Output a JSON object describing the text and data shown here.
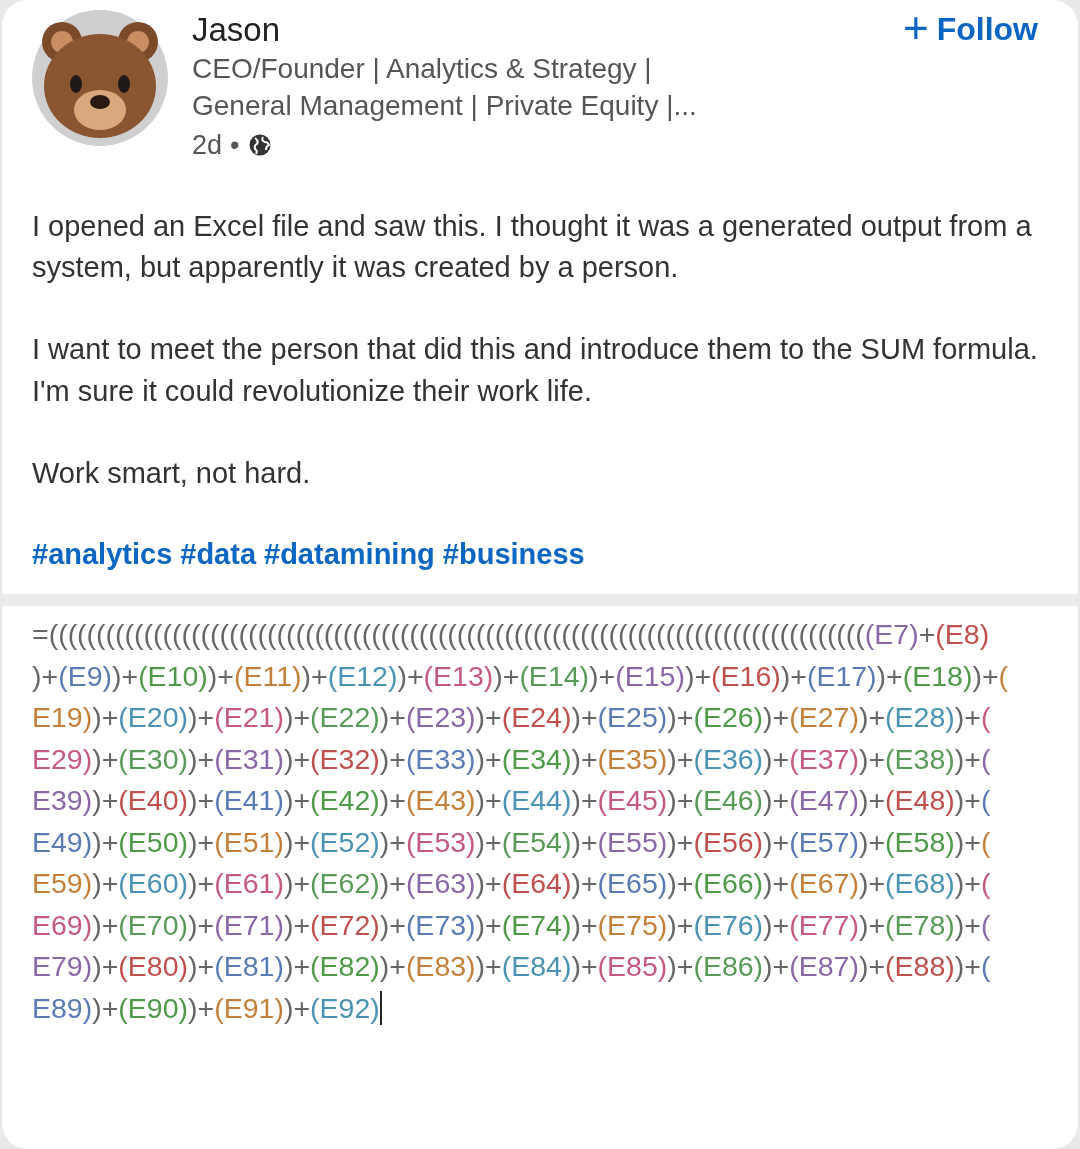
{
  "author": {
    "name": "Jason",
    "headline_lines": [
      "CEO/Founder | Analytics & Strategy |",
      "General Management | Private Equity |..."
    ],
    "time": "2d",
    "separator": "•"
  },
  "follow_button": {
    "icon": "+",
    "label": "Follow"
  },
  "post": {
    "paragraphs": [
      "I opened an Excel file and saw this. I thought it was a generated output from a system, but apparently it was created by a person.",
      "I want to meet the person that did this and introduce them to the SUM formula. I'm sure it could revolutionize their work life.",
      "Work smart, not hard."
    ],
    "hashtags": [
      "#analytics",
      "#data",
      "#datamining",
      "#business"
    ]
  },
  "formula": {
    "cursor_visible": true,
    "lines": [
      [
        {
          "text": "=((((((((((((((((((((((((((((((((((((((((((((((((((((((((((((((((((((((((((((((((((((((",
          "color": "#666666"
        },
        {
          "text": "(E7)",
          "color": "#8a68a8"
        },
        {
          "text": "+",
          "color": "#666666"
        },
        {
          "text": "(E8)",
          "color": "#c0504d"
        }
      ],
      [
        {
          "text": ")+",
          "color": "#666666"
        },
        {
          "text": "(E9)",
          "color": "#5a7bb5"
        },
        {
          "text": ")+",
          "color": "#666666"
        },
        {
          "text": "(E10)",
          "color": "#4e9a48"
        },
        {
          "text": ")+",
          "color": "#666666"
        },
        {
          "text": "(E11)",
          "color": "#c4803a"
        },
        {
          "text": ")+",
          "color": "#666666"
        },
        {
          "text": "(E12)",
          "color": "#4b93b5"
        },
        {
          "text": ")+",
          "color": "#666666"
        },
        {
          "text": "(E13)",
          "color": "#c45a84"
        },
        {
          "text": ")+",
          "color": "#666666"
        },
        {
          "text": "(E14)",
          "color": "#5a9a58"
        },
        {
          "text": ")+",
          "color": "#666666"
        },
        {
          "text": "(E15)",
          "color": "#8a68a8"
        },
        {
          "text": ")+",
          "color": "#666666"
        },
        {
          "text": "(E16)",
          "color": "#c0504d"
        },
        {
          "text": ")+",
          "color": "#666666"
        },
        {
          "text": "(E17)",
          "color": "#5a7bb5"
        },
        {
          "text": ")+",
          "color": "#666666"
        },
        {
          "text": "(E18)",
          "color": "#4e9a48"
        },
        {
          "text": ")+",
          "color": "#666666"
        },
        {
          "text": "(",
          "color": "#c4803a"
        }
      ],
      [
        {
          "text": "E19)",
          "color": "#c4803a"
        },
        {
          "text": ")+",
          "color": "#666666"
        },
        {
          "text": "(E20)",
          "color": "#4b93b5"
        },
        {
          "text": ")+",
          "color": "#666666"
        },
        {
          "text": "(E21)",
          "color": "#c45a84"
        },
        {
          "text": ")+",
          "color": "#666666"
        },
        {
          "text": "(E22)",
          "color": "#5a9a58"
        },
        {
          "text": ")+",
          "color": "#666666"
        },
        {
          "text": "(E23)",
          "color": "#8a68a8"
        },
        {
          "text": ")+",
          "color": "#666666"
        },
        {
          "text": "(E24)",
          "color": "#c0504d"
        },
        {
          "text": ")+",
          "color": "#666666"
        },
        {
          "text": "(E25)",
          "color": "#5a7bb5"
        },
        {
          "text": ")+",
          "color": "#666666"
        },
        {
          "text": "(E26)",
          "color": "#4e9a48"
        },
        {
          "text": ")+",
          "color": "#666666"
        },
        {
          "text": "(E27)",
          "color": "#c4803a"
        },
        {
          "text": ")+",
          "color": "#666666"
        },
        {
          "text": "(E28)",
          "color": "#4b93b5"
        },
        {
          "text": ")+",
          "color": "#666666"
        },
        {
          "text": "(",
          "color": "#c45a84"
        }
      ],
      [
        {
          "text": "E29)",
          "color": "#c45a84"
        },
        {
          "text": ")+",
          "color": "#666666"
        },
        {
          "text": "(E30)",
          "color": "#5a9a58"
        },
        {
          "text": ")+",
          "color": "#666666"
        },
        {
          "text": "(E31)",
          "color": "#8a68a8"
        },
        {
          "text": ")+",
          "color": "#666666"
        },
        {
          "text": "(E32)",
          "color": "#c0504d"
        },
        {
          "text": ")+",
          "color": "#666666"
        },
        {
          "text": "(E33)",
          "color": "#5a7bb5"
        },
        {
          "text": ")+",
          "color": "#666666"
        },
        {
          "text": "(E34)",
          "color": "#4e9a48"
        },
        {
          "text": ")+",
          "color": "#666666"
        },
        {
          "text": "(E35)",
          "color": "#c4803a"
        },
        {
          "text": ")+",
          "color": "#666666"
        },
        {
          "text": "(E36)",
          "color": "#4b93b5"
        },
        {
          "text": ")+",
          "color": "#666666"
        },
        {
          "text": "(E37)",
          "color": "#c45a84"
        },
        {
          "text": ")+",
          "color": "#666666"
        },
        {
          "text": "(E38)",
          "color": "#5a9a58"
        },
        {
          "text": ")+",
          "color": "#666666"
        },
        {
          "text": "(",
          "color": "#8a68a8"
        }
      ],
      [
        {
          "text": "E39)",
          "color": "#8a68a8"
        },
        {
          "text": ")+",
          "color": "#666666"
        },
        {
          "text": "(E40)",
          "color": "#c0504d"
        },
        {
          "text": ")+",
          "color": "#666666"
        },
        {
          "text": "(E41)",
          "color": "#5a7bb5"
        },
        {
          "text": ")+",
          "color": "#666666"
        },
        {
          "text": "(E42)",
          "color": "#4e9a48"
        },
        {
          "text": ")+",
          "color": "#666666"
        },
        {
          "text": "(E43)",
          "color": "#c4803a"
        },
        {
          "text": ")+",
          "color": "#666666"
        },
        {
          "text": "(E44)",
          "color": "#4b93b5"
        },
        {
          "text": ")+",
          "color": "#666666"
        },
        {
          "text": "(E45)",
          "color": "#c45a84"
        },
        {
          "text": ")+",
          "color": "#666666"
        },
        {
          "text": "(E46)",
          "color": "#5a9a58"
        },
        {
          "text": ")+",
          "color": "#666666"
        },
        {
          "text": "(E47)",
          "color": "#8a68a8"
        },
        {
          "text": ")+",
          "color": "#666666"
        },
        {
          "text": "(E48)",
          "color": "#c0504d"
        },
        {
          "text": ")+",
          "color": "#666666"
        },
        {
          "text": "(",
          "color": "#5a7bb5"
        }
      ],
      [
        {
          "text": "E49)",
          "color": "#5a7bb5"
        },
        {
          "text": ")+",
          "color": "#666666"
        },
        {
          "text": "(E50)",
          "color": "#4e9a48"
        },
        {
          "text": ")+",
          "color": "#666666"
        },
        {
          "text": "(E51)",
          "color": "#c4803a"
        },
        {
          "text": ")+",
          "color": "#666666"
        },
        {
          "text": "(E52)",
          "color": "#4b93b5"
        },
        {
          "text": ")+",
          "color": "#666666"
        },
        {
          "text": "(E53)",
          "color": "#c45a84"
        },
        {
          "text": ")+",
          "color": "#666666"
        },
        {
          "text": "(E54)",
          "color": "#5a9a58"
        },
        {
          "text": ")+",
          "color": "#666666"
        },
        {
          "text": "(E55)",
          "color": "#8a68a8"
        },
        {
          "text": ")+",
          "color": "#666666"
        },
        {
          "text": "(E56)",
          "color": "#c0504d"
        },
        {
          "text": ")+",
          "color": "#666666"
        },
        {
          "text": "(E57)",
          "color": "#5a7bb5"
        },
        {
          "text": ")+",
          "color": "#666666"
        },
        {
          "text": "(E58)",
          "color": "#4e9a48"
        },
        {
          "text": ")+",
          "color": "#666666"
        },
        {
          "text": "(",
          "color": "#c4803a"
        }
      ],
      [
        {
          "text": "E59)",
          "color": "#c4803a"
        },
        {
          "text": ")+",
          "color": "#666666"
        },
        {
          "text": "(E60)",
          "color": "#4b93b5"
        },
        {
          "text": ")+",
          "color": "#666666"
        },
        {
          "text": "(E61)",
          "color": "#c45a84"
        },
        {
          "text": ")+",
          "color": "#666666"
        },
        {
          "text": "(E62)",
          "color": "#5a9a58"
        },
        {
          "text": ")+",
          "color": "#666666"
        },
        {
          "text": "(E63)",
          "color": "#8a68a8"
        },
        {
          "text": ")+",
          "color": "#666666"
        },
        {
          "text": "(E64)",
          "color": "#c0504d"
        },
        {
          "text": ")+",
          "color": "#666666"
        },
        {
          "text": "(E65)",
          "color": "#5a7bb5"
        },
        {
          "text": ")+",
          "color": "#666666"
        },
        {
          "text": "(E66)",
          "color": "#4e9a48"
        },
        {
          "text": ")+",
          "color": "#666666"
        },
        {
          "text": "(E67)",
          "color": "#c4803a"
        },
        {
          "text": ")+",
          "color": "#666666"
        },
        {
          "text": "(E68)",
          "color": "#4b93b5"
        },
        {
          "text": ")+",
          "color": "#666666"
        },
        {
          "text": "(",
          "color": "#c45a84"
        }
      ],
      [
        {
          "text": "E69)",
          "color": "#c45a84"
        },
        {
          "text": ")+",
          "color": "#666666"
        },
        {
          "text": "(E70)",
          "color": "#5a9a58"
        },
        {
          "text": ")+",
          "color": "#666666"
        },
        {
          "text": "(E71)",
          "color": "#8a68a8"
        },
        {
          "text": ")+",
          "color": "#666666"
        },
        {
          "text": "(E72)",
          "color": "#c0504d"
        },
        {
          "text": ")+",
          "color": "#666666"
        },
        {
          "text": "(E73)",
          "color": "#5a7bb5"
        },
        {
          "text": ")+",
          "color": "#666666"
        },
        {
          "text": "(E74)",
          "color": "#4e9a48"
        },
        {
          "text": ")+",
          "color": "#666666"
        },
        {
          "text": "(E75)",
          "color": "#c4803a"
        },
        {
          "text": ")+",
          "color": "#666666"
        },
        {
          "text": "(E76)",
          "color": "#4b93b5"
        },
        {
          "text": ")+",
          "color": "#666666"
        },
        {
          "text": "(E77)",
          "color": "#c45a84"
        },
        {
          "text": ")+",
          "color": "#666666"
        },
        {
          "text": "(E78)",
          "color": "#5a9a58"
        },
        {
          "text": ")+",
          "color": "#666666"
        },
        {
          "text": "(",
          "color": "#8a68a8"
        }
      ],
      [
        {
          "text": "E79)",
          "color": "#8a68a8"
        },
        {
          "text": ")+",
          "color": "#666666"
        },
        {
          "text": "(E80)",
          "color": "#c0504d"
        },
        {
          "text": ")+",
          "color": "#666666"
        },
        {
          "text": "(E81)",
          "color": "#5a7bb5"
        },
        {
          "text": ")+",
          "color": "#666666"
        },
        {
          "text": "(E82)",
          "color": "#4e9a48"
        },
        {
          "text": ")+",
          "color": "#666666"
        },
        {
          "text": "(E83)",
          "color": "#c4803a"
        },
        {
          "text": ")+",
          "color": "#666666"
        },
        {
          "text": "(E84)",
          "color": "#4b93b5"
        },
        {
          "text": ")+",
          "color": "#666666"
        },
        {
          "text": "(E85)",
          "color": "#c45a84"
        },
        {
          "text": ")+",
          "color": "#666666"
        },
        {
          "text": "(E86)",
          "color": "#5a9a58"
        },
        {
          "text": ")+",
          "color": "#666666"
        },
        {
          "text": "(E87)",
          "color": "#8a68a8"
        },
        {
          "text": ")+",
          "color": "#666666"
        },
        {
          "text": "(E88)",
          "color": "#c0504d"
        },
        {
          "text": ")+",
          "color": "#666666"
        },
        {
          "text": "(",
          "color": "#5a7bb5"
        }
      ],
      [
        {
          "text": "E89)",
          "color": "#5a7bb5"
        },
        {
          "text": ")+",
          "color": "#666666"
        },
        {
          "text": "(E90)",
          "color": "#4e9a48"
        },
        {
          "text": ")+",
          "color": "#666666"
        },
        {
          "text": "(E91)",
          "color": "#c4803a"
        },
        {
          "text": ")+",
          "color": "#666666"
        },
        {
          "text": "(E92)",
          "color": "#4b93b5"
        }
      ]
    ]
  }
}
